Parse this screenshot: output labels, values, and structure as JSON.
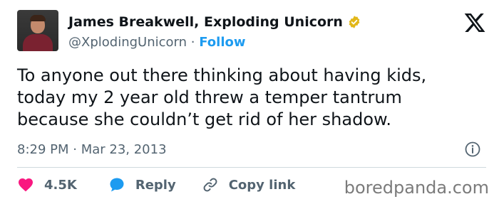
{
  "author": {
    "name": "James Breakwell, Exploding Unicorn",
    "handle": "@XplodingUnicorn",
    "separator": "·",
    "follow_label": "Follow",
    "verified_badge": "gold-verified-badge-icon"
  },
  "tweet": {
    "lines": [
      "To anyone out there thinking about having kids,",
      "today my 2 year old threw a temper tantrum",
      "because she couldn’t get rid of her shadow."
    ],
    "timestamp": "8:29 PM · Mar 23, 2013"
  },
  "actions": {
    "like_count": "4.5K",
    "reply_label": "Reply",
    "copy_link_label": "Copy link"
  },
  "watermark": "boredpanda.com",
  "colors": {
    "accent": "#1d9bf0",
    "like": "#f91880",
    "verified": "#e2b719",
    "text": "#0f1419",
    "muted": "#536471"
  },
  "icons": [
    "avatar",
    "gold-verified-badge-icon",
    "x-logo-icon",
    "info-icon",
    "heart-icon",
    "reply-bubble-icon",
    "link-icon"
  ]
}
